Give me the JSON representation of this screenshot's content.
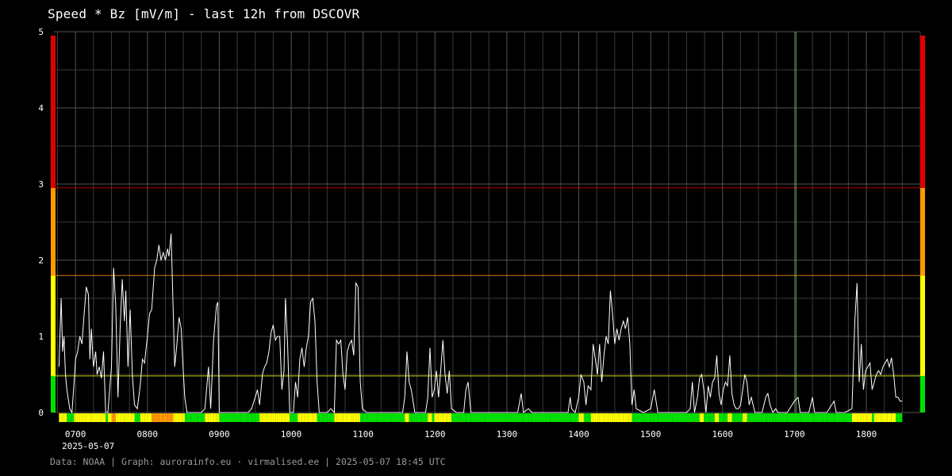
{
  "title": "Speed * Bz [mV/m] - last 12h from DSCOVR",
  "footer": "Data: NOAA | Graph: aurorainfo.eu · virmalised.ee | 2025-05-07 18:45 UTC",
  "date_label": "2025-05-07",
  "colors": {
    "background": "#000000",
    "grid": "#3a3a3a",
    "line": "#ffffff",
    "green": "#00e000",
    "yellow": "#ffff00",
    "orange": "#ff9900",
    "red": "#e00000",
    "marker": "#66cc66"
  },
  "chart_data": {
    "type": "line",
    "title": "Speed * Bz [mV/m] - last 12h from DSCOVR",
    "xlabel": "",
    "ylabel": "",
    "xlim": [
      6.7,
      18.75
    ],
    "ylim": [
      0,
      5
    ],
    "x_unit": "hour (UTC)",
    "x_ticks": [
      {
        "value": 7,
        "label": "0700"
      },
      {
        "value": 8,
        "label": "0800"
      },
      {
        "value": 9,
        "label": "0900"
      },
      {
        "value": 10,
        "label": "1000"
      },
      {
        "value": 11,
        "label": "1100"
      },
      {
        "value": 12,
        "label": "1200"
      },
      {
        "value": 13,
        "label": "1300"
      },
      {
        "value": 14,
        "label": "1400"
      },
      {
        "value": 15,
        "label": "1500"
      },
      {
        "value": 16,
        "label": "1600"
      },
      {
        "value": 17,
        "label": "1700"
      },
      {
        "value": 18,
        "label": "1800"
      }
    ],
    "y_ticks": [
      0,
      1,
      2,
      3,
      4,
      5
    ],
    "grid": true,
    "thresholds": [
      {
        "value": 0.48,
        "color": "#ffff00"
      },
      {
        "value": 1.8,
        "color": "#ff9900"
      },
      {
        "value": 2.95,
        "color": "#e00000"
      }
    ],
    "level_bands": [
      {
        "from": 0,
        "to": 0.48,
        "color": "#00e000"
      },
      {
        "from": 0.48,
        "to": 1.8,
        "color": "#ffff00"
      },
      {
        "from": 1.8,
        "to": 2.95,
        "color": "#ff9900"
      },
      {
        "from": 2.95,
        "to": 4.95,
        "color": "#e00000"
      }
    ],
    "vertical_marker": {
      "x": 17.02,
      "color": "#66cc66"
    },
    "series": [
      {
        "points": [
          [
            6.77,
            0.6
          ],
          [
            6.8,
            1.5
          ],
          [
            6.82,
            0.8
          ],
          [
            6.84,
            1.0
          ],
          [
            6.86,
            0.5
          ],
          [
            6.88,
            0.3
          ],
          [
            6.92,
            0.05
          ],
          [
            6.95,
            0.0
          ],
          [
            6.98,
            0.4
          ],
          [
            7.0,
            0.7
          ],
          [
            7.03,
            0.8
          ],
          [
            7.06,
            1.0
          ],
          [
            7.09,
            0.9
          ],
          [
            7.12,
            1.3
          ],
          [
            7.15,
            1.65
          ],
          [
            7.18,
            1.55
          ],
          [
            7.2,
            0.7
          ],
          [
            7.22,
            1.1
          ],
          [
            7.25,
            0.6
          ],
          [
            7.28,
            0.8
          ],
          [
            7.3,
            0.5
          ],
          [
            7.33,
            0.6
          ],
          [
            7.36,
            0.45
          ],
          [
            7.39,
            0.8
          ],
          [
            7.42,
            0.0
          ],
          [
            7.45,
            0.0
          ],
          [
            7.5,
            0.6
          ],
          [
            7.53,
            1.9
          ],
          [
            7.56,
            1.4
          ],
          [
            7.59,
            0.2
          ],
          [
            7.62,
            1.1
          ],
          [
            7.65,
            1.75
          ],
          [
            7.68,
            1.2
          ],
          [
            7.7,
            1.6
          ],
          [
            7.73,
            0.6
          ],
          [
            7.76,
            1.35
          ],
          [
            7.79,
            0.5
          ],
          [
            7.82,
            0.1
          ],
          [
            7.86,
            0.05
          ],
          [
            7.9,
            0.35
          ],
          [
            7.93,
            0.7
          ],
          [
            7.96,
            0.65
          ],
          [
            8.0,
            1.0
          ],
          [
            8.03,
            1.3
          ],
          [
            8.06,
            1.35
          ],
          [
            8.1,
            1.9
          ],
          [
            8.13,
            2.0
          ],
          [
            8.16,
            2.2
          ],
          [
            8.19,
            2.0
          ],
          [
            8.22,
            2.1
          ],
          [
            8.25,
            2.0
          ],
          [
            8.28,
            2.15
          ],
          [
            8.3,
            2.05
          ],
          [
            8.33,
            2.35
          ],
          [
            8.36,
            1.3
          ],
          [
            8.38,
            0.6
          ],
          [
            8.41,
            0.9
          ],
          [
            8.44,
            1.25
          ],
          [
            8.47,
            1.1
          ],
          [
            8.49,
            0.7
          ],
          [
            8.52,
            0.2
          ],
          [
            8.55,
            0.0
          ],
          [
            8.6,
            0.0
          ],
          [
            8.7,
            0.0
          ],
          [
            8.75,
            0.0
          ],
          [
            8.8,
            0.05
          ],
          [
            8.85,
            0.6
          ],
          [
            8.88,
            0.05
          ],
          [
            8.92,
            0.95
          ],
          [
            8.96,
            1.4
          ],
          [
            8.98,
            1.45
          ],
          [
            9.0,
            0.0
          ],
          [
            9.1,
            0.0
          ],
          [
            9.2,
            0.0
          ],
          [
            9.3,
            0.0
          ],
          [
            9.4,
            0.0
          ],
          [
            9.45,
            0.05
          ],
          [
            9.5,
            0.2
          ],
          [
            9.53,
            0.3
          ],
          [
            9.56,
            0.1
          ],
          [
            9.6,
            0.5
          ],
          [
            9.63,
            0.6
          ],
          [
            9.66,
            0.65
          ],
          [
            9.69,
            0.8
          ],
          [
            9.72,
            1.05
          ],
          [
            9.75,
            1.15
          ],
          [
            9.78,
            0.95
          ],
          [
            9.81,
            1.0
          ],
          [
            9.84,
            1.0
          ],
          [
            9.87,
            0.3
          ],
          [
            9.9,
            0.55
          ],
          [
            9.92,
            1.5
          ],
          [
            9.95,
            0.9
          ],
          [
            9.98,
            0.0
          ],
          [
            10.03,
            0.0
          ],
          [
            10.06,
            0.4
          ],
          [
            10.09,
            0.2
          ],
          [
            10.12,
            0.7
          ],
          [
            10.15,
            0.85
          ],
          [
            10.18,
            0.6
          ],
          [
            10.21,
            0.85
          ],
          [
            10.24,
            1.0
          ],
          [
            10.27,
            1.45
          ],
          [
            10.3,
            1.5
          ],
          [
            10.33,
            1.2
          ],
          [
            10.36,
            0.4
          ],
          [
            10.39,
            0.0
          ],
          [
            10.45,
            0.0
          ],
          [
            10.5,
            0.0
          ],
          [
            10.55,
            0.05
          ],
          [
            10.6,
            0.0
          ],
          [
            10.63,
            0.95
          ],
          [
            10.66,
            0.9
          ],
          [
            10.69,
            0.95
          ],
          [
            10.72,
            0.5
          ],
          [
            10.75,
            0.3
          ],
          [
            10.78,
            0.8
          ],
          [
            10.81,
            0.9
          ],
          [
            10.84,
            0.95
          ],
          [
            10.87,
            0.75
          ],
          [
            10.9,
            1.7
          ],
          [
            10.93,
            1.65
          ],
          [
            10.96,
            0.4
          ],
          [
            10.99,
            0.05
          ],
          [
            11.05,
            0.0
          ],
          [
            11.2,
            0.0
          ],
          [
            11.4,
            0.0
          ],
          [
            11.5,
            0.0
          ],
          [
            11.55,
            0.0
          ],
          [
            11.58,
            0.2
          ],
          [
            11.61,
            0.8
          ],
          [
            11.64,
            0.4
          ],
          [
            11.67,
            0.3
          ],
          [
            11.72,
            0.0
          ],
          [
            11.8,
            0.0
          ],
          [
            11.87,
            0.0
          ],
          [
            11.9,
            0.2
          ],
          [
            11.93,
            0.85
          ],
          [
            11.96,
            0.2
          ],
          [
            11.99,
            0.3
          ],
          [
            12.02,
            0.55
          ],
          [
            12.05,
            0.2
          ],
          [
            12.08,
            0.55
          ],
          [
            12.11,
            0.95
          ],
          [
            12.14,
            0.5
          ],
          [
            12.17,
            0.25
          ],
          [
            12.2,
            0.55
          ],
          [
            12.23,
            0.05
          ],
          [
            12.3,
            0.0
          ],
          [
            12.4,
            0.0
          ],
          [
            12.43,
            0.3
          ],
          [
            12.46,
            0.4
          ],
          [
            12.5,
            0.0
          ],
          [
            12.7,
            0.0
          ],
          [
            13.0,
            0.0
          ],
          [
            13.15,
            0.0
          ],
          [
            13.2,
            0.25
          ],
          [
            13.23,
            0.0
          ],
          [
            13.3,
            0.05
          ],
          [
            13.35,
            0.0
          ],
          [
            13.6,
            0.0
          ],
          [
            13.85,
            0.0
          ],
          [
            13.88,
            0.2
          ],
          [
            13.9,
            0.05
          ],
          [
            13.95,
            0.0
          ],
          [
            14.0,
            0.2
          ],
          [
            14.03,
            0.5
          ],
          [
            14.07,
            0.4
          ],
          [
            14.1,
            0.1
          ],
          [
            14.13,
            0.35
          ],
          [
            14.17,
            0.3
          ],
          [
            14.2,
            0.9
          ],
          [
            14.23,
            0.7
          ],
          [
            14.26,
            0.5
          ],
          [
            14.29,
            0.9
          ],
          [
            14.32,
            0.4
          ],
          [
            14.35,
            0.75
          ],
          [
            14.38,
            1.0
          ],
          [
            14.41,
            0.9
          ],
          [
            14.44,
            1.6
          ],
          [
            14.47,
            1.3
          ],
          [
            14.5,
            0.9
          ],
          [
            14.53,
            1.1
          ],
          [
            14.56,
            0.95
          ],
          [
            14.59,
            1.1
          ],
          [
            14.62,
            1.2
          ],
          [
            14.65,
            1.1
          ],
          [
            14.68,
            1.25
          ],
          [
            14.71,
            0.9
          ],
          [
            14.74,
            0.1
          ],
          [
            14.77,
            0.3
          ],
          [
            14.8,
            0.05
          ],
          [
            14.9,
            0.0
          ],
          [
            15.0,
            0.05
          ],
          [
            15.05,
            0.3
          ],
          [
            15.1,
            0.0
          ],
          [
            15.3,
            0.0
          ],
          [
            15.5,
            0.0
          ],
          [
            15.55,
            0.05
          ],
          [
            15.58,
            0.4
          ],
          [
            15.61,
            0.0
          ],
          [
            15.65,
            0.2
          ],
          [
            15.68,
            0.45
          ],
          [
            15.71,
            0.5
          ],
          [
            15.74,
            0.3
          ],
          [
            15.77,
            0.0
          ],
          [
            15.8,
            0.35
          ],
          [
            15.83,
            0.2
          ],
          [
            15.86,
            0.4
          ],
          [
            15.89,
            0.45
          ],
          [
            15.92,
            0.75
          ],
          [
            15.95,
            0.25
          ],
          [
            15.98,
            0.1
          ],
          [
            16.01,
            0.3
          ],
          [
            16.04,
            0.4
          ],
          [
            16.07,
            0.35
          ],
          [
            16.1,
            0.75
          ],
          [
            16.13,
            0.25
          ],
          [
            16.16,
            0.1
          ],
          [
            16.19,
            0.05
          ],
          [
            16.22,
            0.05
          ],
          [
            16.25,
            0.1
          ],
          [
            16.28,
            0.3
          ],
          [
            16.31,
            0.5
          ],
          [
            16.34,
            0.4
          ],
          [
            16.37,
            0.1
          ],
          [
            16.4,
            0.2
          ],
          [
            16.45,
            0.0
          ],
          [
            16.55,
            0.0
          ],
          [
            16.6,
            0.2
          ],
          [
            16.63,
            0.25
          ],
          [
            16.66,
            0.1
          ],
          [
            16.7,
            0.0
          ],
          [
            16.74,
            0.05
          ],
          [
            16.77,
            0.0
          ],
          [
            16.9,
            0.0
          ],
          [
            17.0,
            0.15
          ],
          [
            17.05,
            0.2
          ],
          [
            17.08,
            0.0
          ],
          [
            17.2,
            0.0
          ],
          [
            17.25,
            0.2
          ],
          [
            17.28,
            0.0
          ],
          [
            17.4,
            0.0
          ],
          [
            17.45,
            0.0
          ],
          [
            17.55,
            0.15
          ],
          [
            17.58,
            0.0
          ],
          [
            17.7,
            0.0
          ],
          [
            17.8,
            0.05
          ],
          [
            17.84,
            1.2
          ],
          [
            17.87,
            1.7
          ],
          [
            17.9,
            0.4
          ],
          [
            17.93,
            0.9
          ],
          [
            17.96,
            0.3
          ],
          [
            17.99,
            0.55
          ],
          [
            18.02,
            0.6
          ],
          [
            18.05,
            0.65
          ],
          [
            18.08,
            0.3
          ],
          [
            18.11,
            0.4
          ],
          [
            18.14,
            0.5
          ],
          [
            18.17,
            0.55
          ],
          [
            18.2,
            0.5
          ],
          [
            18.23,
            0.6
          ],
          [
            18.26,
            0.65
          ],
          [
            18.29,
            0.7
          ],
          [
            18.32,
            0.6
          ],
          [
            18.35,
            0.72
          ],
          [
            18.38,
            0.5
          ],
          [
            18.41,
            0.2
          ],
          [
            18.44,
            0.2
          ],
          [
            18.47,
            0.15
          ],
          [
            18.5,
            0.15
          ]
        ]
      }
    ]
  }
}
